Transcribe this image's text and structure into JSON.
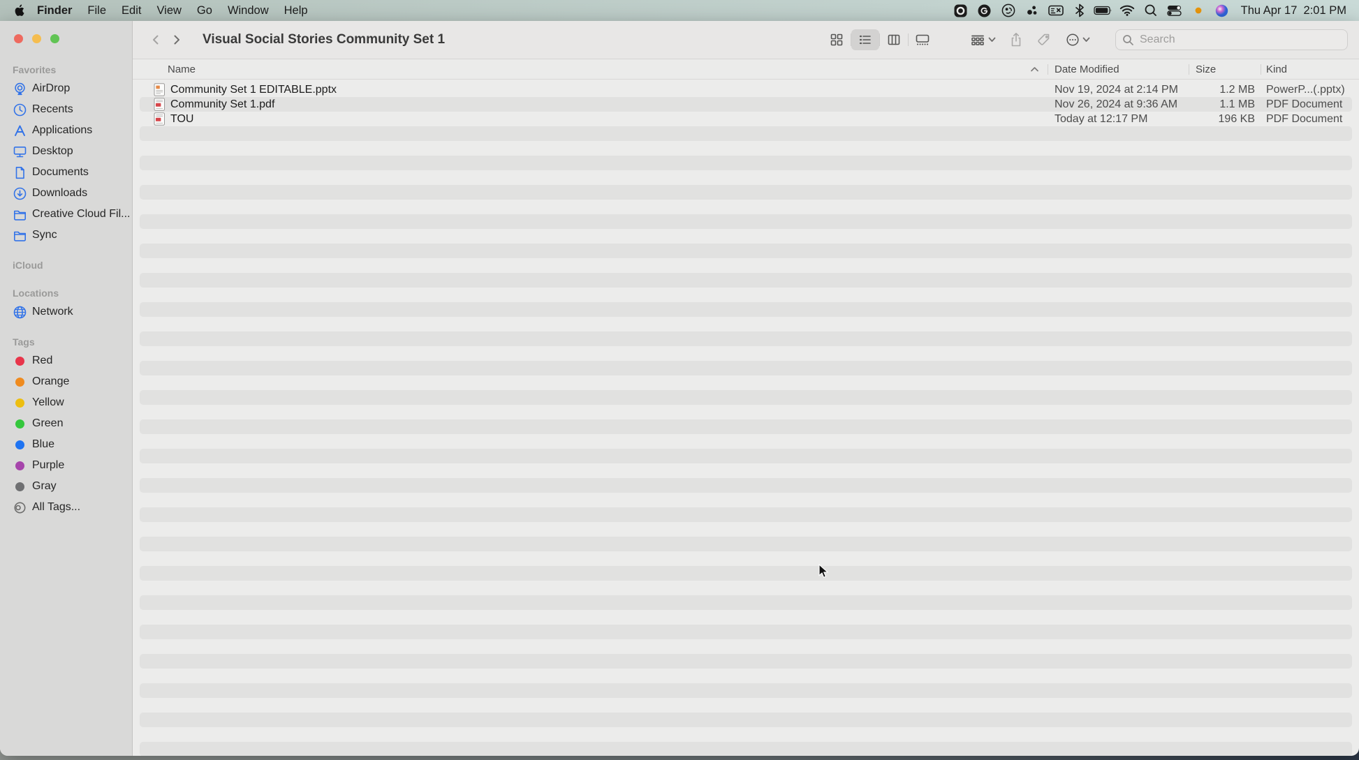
{
  "menubar": {
    "apple_icon": "apple-icon",
    "menus": [
      "Finder",
      "File",
      "Edit",
      "View",
      "Go",
      "Window",
      "Help"
    ],
    "active_app_menu": "Finder",
    "status_icons": [
      "record-stop-icon",
      "grammarly-icon",
      "shapes-app-icon",
      "dots-app-icon",
      "input-source-icon",
      "bluetooth-icon",
      "battery-icon",
      "wifi-icon",
      "spotlight-icon",
      "control-center-icon",
      "recording-indicator-dot",
      "siri-icon"
    ],
    "clock": "Thu Apr 17  2:01 PM"
  },
  "window": {
    "traffic_lights": {
      "close": "#ee6a5f",
      "minimize": "#f5bd4f",
      "zoom": "#61c454"
    },
    "toolbar": {
      "title": "Visual Social Stories Community Set 1",
      "view_buttons": [
        {
          "name": "icon-view",
          "icon": "grid-view-icon",
          "selected": false
        },
        {
          "name": "list-view",
          "icon": "list-view-icon",
          "selected": true
        },
        {
          "name": "column-view",
          "icon": "columns-view-icon",
          "selected": false
        },
        {
          "name": "gallery-view",
          "icon": "gallery-view-icon",
          "selected": false
        }
      ],
      "action_buttons": [
        {
          "name": "group-button",
          "icon": "group-icon",
          "chevron": true,
          "disabled": false
        },
        {
          "name": "share-button",
          "icon": "share-icon",
          "chevron": false,
          "disabled": true
        },
        {
          "name": "tag-button",
          "icon": "tag-icon",
          "chevron": false,
          "disabled": true
        },
        {
          "name": "more-button",
          "icon": "more-icon",
          "chevron": true,
          "disabled": false
        }
      ],
      "search_placeholder": "Search"
    },
    "sidebar": {
      "accent_color": "#3273e8",
      "sections": [
        {
          "title": "Favorites",
          "items": [
            {
              "label": "AirDrop",
              "icon": "airdrop-icon"
            },
            {
              "label": "Recents",
              "icon": "recents-icon"
            },
            {
              "label": "Applications",
              "icon": "applications-icon"
            },
            {
              "label": "Desktop",
              "icon": "desktop-icon"
            },
            {
              "label": "Documents",
              "icon": "documents-icon"
            },
            {
              "label": "Downloads",
              "icon": "downloads-icon"
            },
            {
              "label": "Creative Cloud Fil...",
              "icon": "folder-icon"
            },
            {
              "label": "Sync",
              "icon": "folder-icon"
            }
          ]
        },
        {
          "title": "iCloud",
          "items": []
        },
        {
          "title": "Locations",
          "items": [
            {
              "label": "Network",
              "icon": "network-icon"
            }
          ]
        },
        {
          "title": "Tags",
          "items": [
            {
              "label": "Red",
              "icon": "tag-dot",
              "color": "#e8354a"
            },
            {
              "label": "Orange",
              "icon": "tag-dot",
              "color": "#ef8b1f"
            },
            {
              "label": "Yellow",
              "icon": "tag-dot",
              "color": "#edbe10"
            },
            {
              "label": "Green",
              "icon": "tag-dot",
              "color": "#34c73c"
            },
            {
              "label": "Blue",
              "icon": "tag-dot",
              "color": "#1f74f2"
            },
            {
              "label": "Purple",
              "icon": "tag-dot",
              "color": "#a645ab"
            },
            {
              "label": "Gray",
              "icon": "tag-dot",
              "color": "#6f7072"
            },
            {
              "label": "All Tags...",
              "icon": "all-tags-icon"
            }
          ]
        }
      ]
    },
    "list": {
      "columns": [
        "Name",
        "Date Modified",
        "Size",
        "Kind"
      ],
      "sort_column": "Name",
      "sort_direction": "ascending",
      "files": [
        {
          "name": "Community Set 1 EDITABLE.pptx",
          "date_modified": "Nov 19, 2024 at 2:14 PM",
          "size": "1.2 MB",
          "kind": "PowerP...(.pptx)",
          "icon": "pptx-file-icon"
        },
        {
          "name": "Community Set 1.pdf",
          "date_modified": "Nov 26, 2024 at 9:36 AM",
          "size": "1.1 MB",
          "kind": "PDF Document",
          "icon": "pdf-file-icon"
        },
        {
          "name": "TOU",
          "date_modified": "Today at 12:17 PM",
          "size": "196 KB",
          "kind": "PDF Document",
          "icon": "pdf-file-icon"
        }
      ]
    }
  }
}
